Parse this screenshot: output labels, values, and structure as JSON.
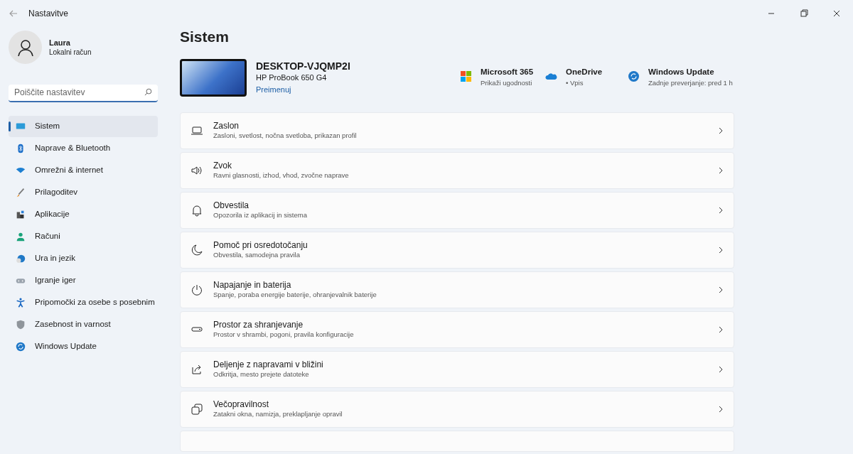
{
  "window": {
    "title": "Nastavitve"
  },
  "user": {
    "name": "Laura",
    "account": "Lokalni račun"
  },
  "search": {
    "placeholder": "Poiščite nastavitev"
  },
  "sidebar": {
    "items": [
      {
        "label": "Sistem",
        "selected": true
      },
      {
        "label": "Naprave & Bluetooth",
        "selected": false
      },
      {
        "label": "Omrežni & internet",
        "selected": false
      },
      {
        "label": "Prilagoditev",
        "selected": false
      },
      {
        "label": "Aplikacije",
        "selected": false
      },
      {
        "label": "Računi",
        "selected": false
      },
      {
        "label": "Ura in jezik",
        "selected": false
      },
      {
        "label": "Igranje iger",
        "selected": false
      },
      {
        "label": "Pripomočki za osebe s posebnim",
        "selected": false
      },
      {
        "label": "Zasebnost in varnost",
        "selected": false
      },
      {
        "label": "Windows Update",
        "selected": false
      }
    ]
  },
  "page": {
    "title": "Sistem"
  },
  "device": {
    "name": "DESKTOP-VJQMP2I",
    "model": "HP ProBook 650 G4",
    "rename_link": "Preimenuj"
  },
  "quick_links": [
    {
      "title": "Microsoft 365",
      "subtitle": "Prikaži ugodnosti"
    },
    {
      "title": "OneDrive",
      "subtitle": "• Vpis"
    },
    {
      "title": "Windows Update",
      "subtitle": "Zadnje preverjanje: pred 1 h"
    }
  ],
  "settings": [
    {
      "title": "Zaslon",
      "description": "Zasloni, svetlost, nočna svetloba, prikazan profil"
    },
    {
      "title": "Zvok",
      "description": "Ravni glasnosti, izhod, vhod, zvočne naprave"
    },
    {
      "title": "Obvestila",
      "description": "Opozorila iz aplikacij in sistema"
    },
    {
      "title": "Pomoč pri osredotočanju",
      "description": "Obvestila, samodejna pravila"
    },
    {
      "title": "Napajanje in baterija",
      "description": "Spanje, poraba energije baterije, ohranjevalnik baterije"
    },
    {
      "title": "Prostor za shranjevanje",
      "description": "Prostor v shrambi, pogoni, pravila konfiguracije"
    },
    {
      "title": "Deljenje z napravami v bližini",
      "description": "Odkritja, mesto prejete datoteke"
    },
    {
      "title": "Večopravilnost",
      "description": "Zatakni okna, namizja, preklapljanje opravil"
    }
  ]
}
